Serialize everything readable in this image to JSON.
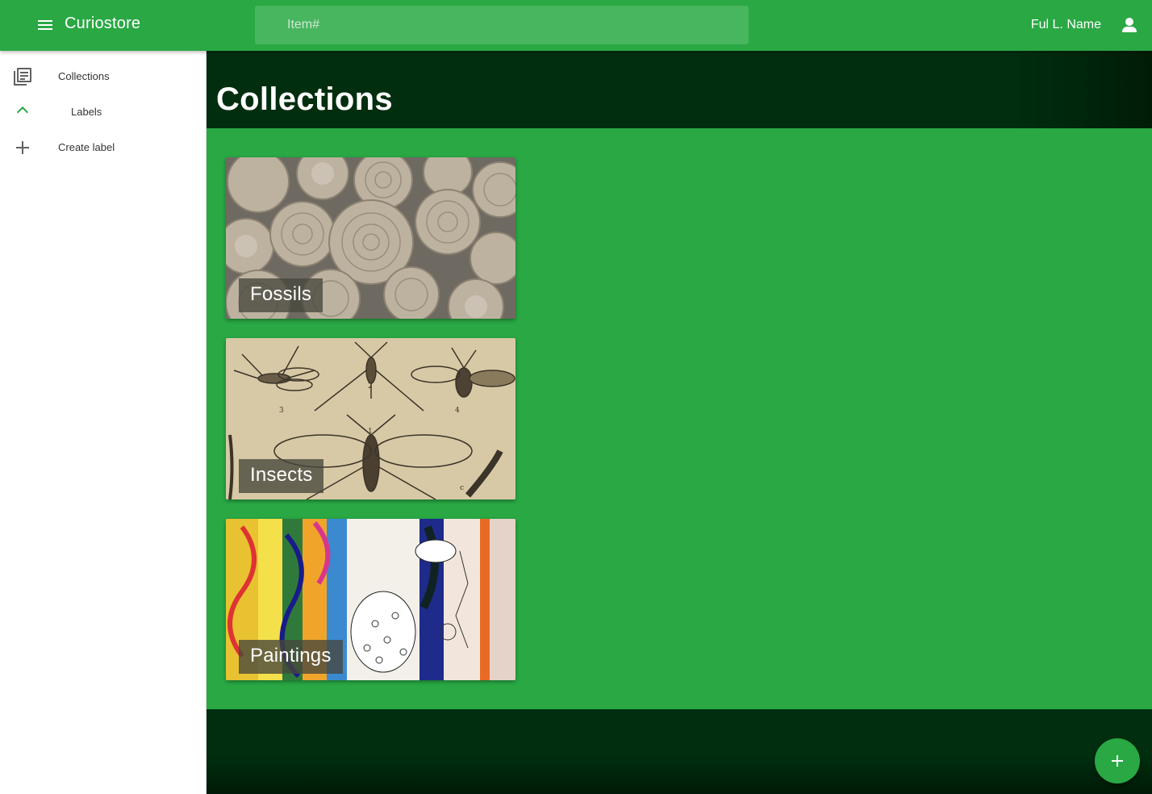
{
  "app": {
    "title": "Curiostore",
    "menu_icon": "menu-icon",
    "accent_color": "#29a844"
  },
  "search": {
    "placeholder": "Item#",
    "value": ""
  },
  "user": {
    "name": "Ful L. Name",
    "icon": "person-icon"
  },
  "sidebar": {
    "items": [
      {
        "label": "Collections",
        "icon": "library-books-icon"
      },
      {
        "label": "Labels",
        "icon": "chevron-up-icon"
      },
      {
        "label": "Create label",
        "icon": "plus-icon"
      }
    ]
  },
  "main": {
    "title": "Collections",
    "collections": [
      {
        "label": "Fossils",
        "image": "ammonite-fossils-photo"
      },
      {
        "label": "Insects",
        "image": "insect-engraving-illustration"
      },
      {
        "label": "Paintings",
        "image": "colorful-painting-photo"
      }
    ]
  },
  "fab": {
    "icon": "plus-icon"
  }
}
